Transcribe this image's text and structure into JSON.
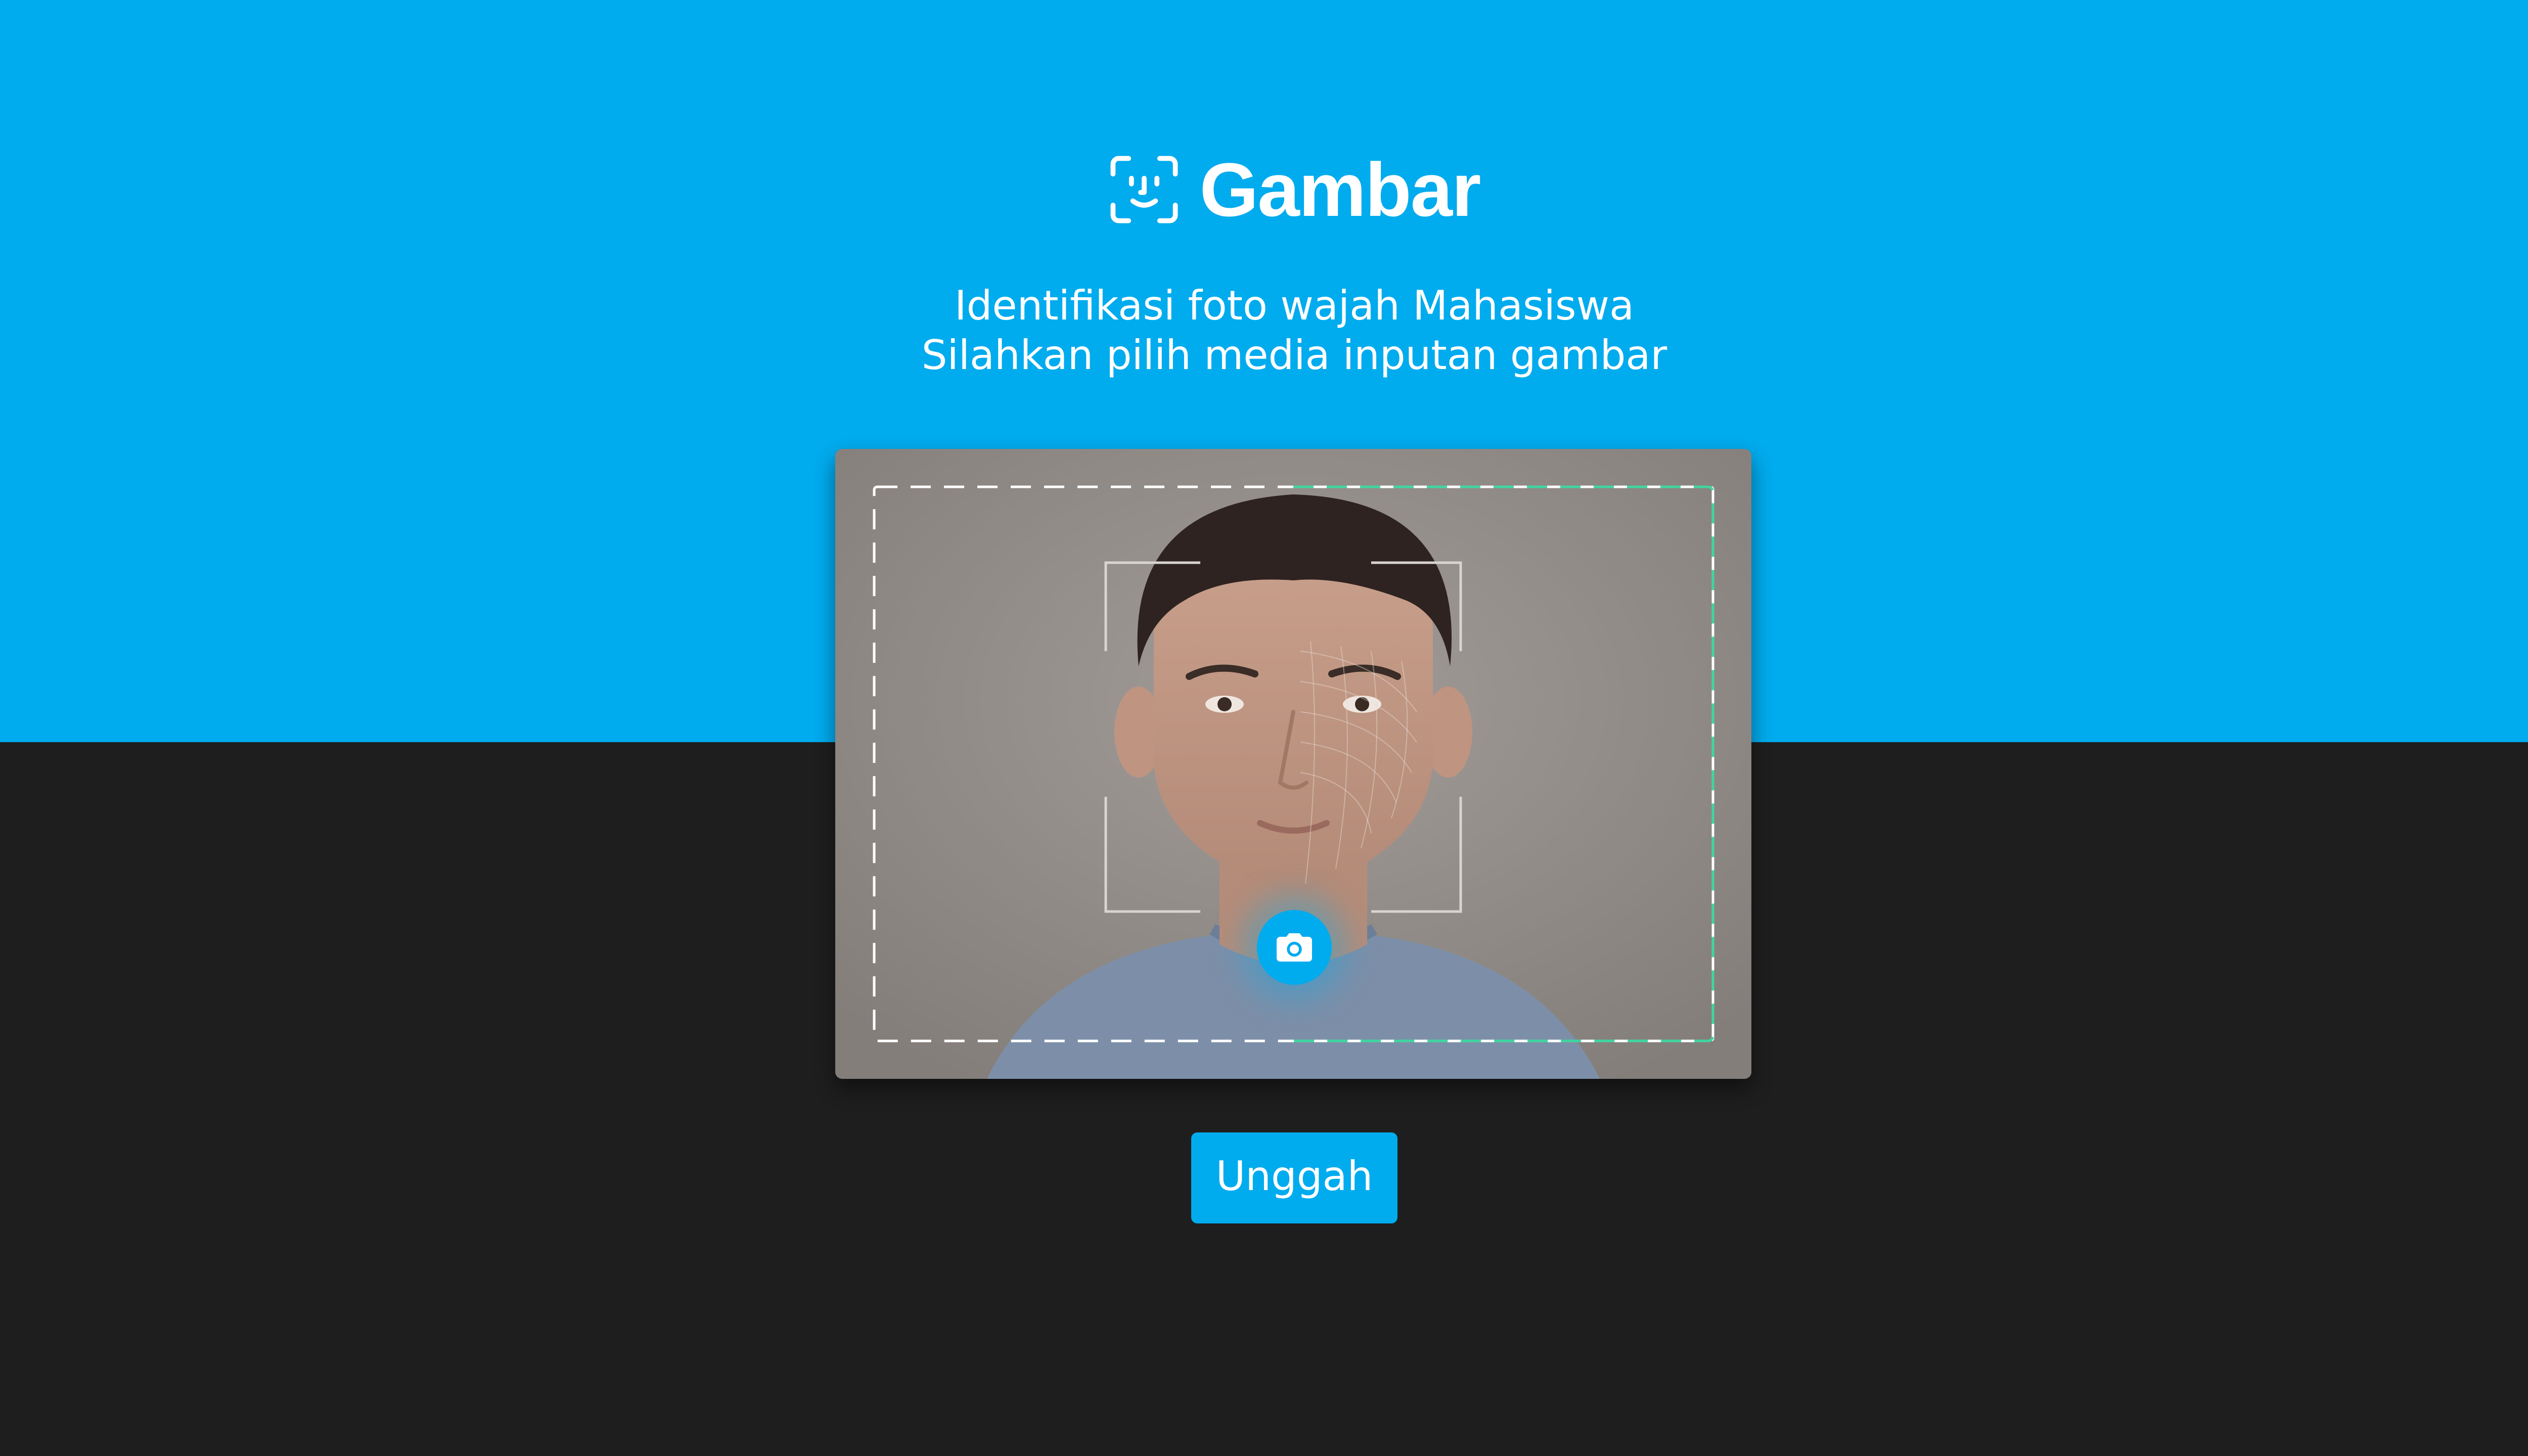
{
  "header": {
    "logo_icon": "face-id-icon",
    "title": "Gambar"
  },
  "subtitle": {
    "line1": "Identifikasi foto wajah Mahasiswa",
    "line2": "Silahkan pilih media inputan gambar"
  },
  "preview": {
    "image": "face-photo-with-scan-overlay",
    "capture_icon": "camera-icon"
  },
  "actions": {
    "upload_label": "Unggah"
  },
  "colors": {
    "accent": "#00abee",
    "dark_background": "#1e1e1e",
    "scan_frame": "#3fd6a0"
  }
}
